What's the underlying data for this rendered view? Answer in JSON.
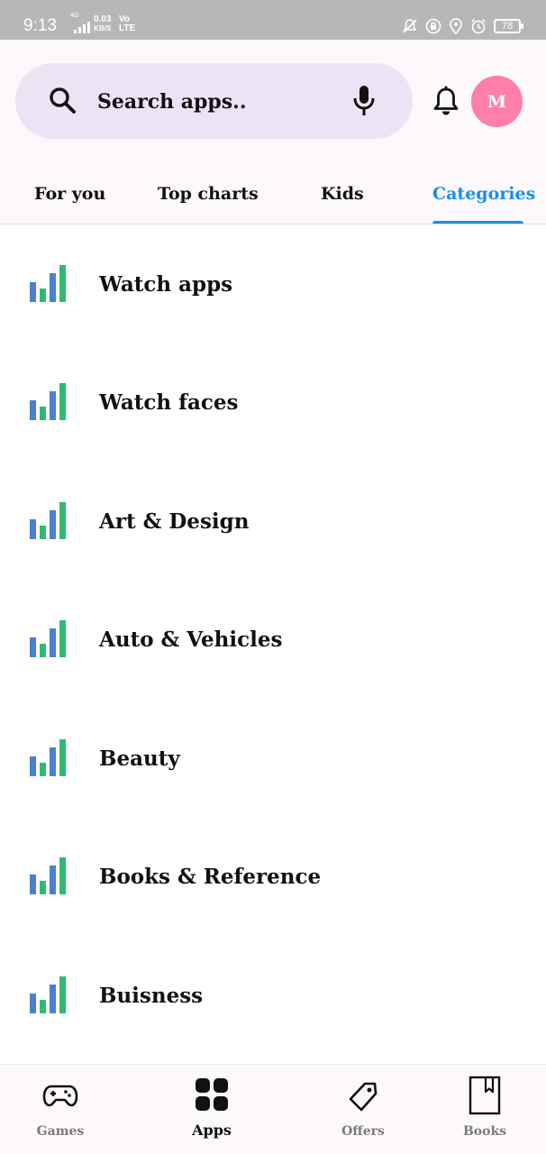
{
  "status_bar": {
    "time": "9:13",
    "network_type": "4G",
    "speed_value": "0.03",
    "speed_unit": "KB/S",
    "volte_top": "Vo",
    "volte_bottom": "LTE",
    "battery": "78"
  },
  "search": {
    "placeholder": "Search apps..",
    "mic_icon": "mic-icon",
    "search_icon": "search-icon"
  },
  "header": {
    "notification_icon": "bell-icon",
    "avatar_letter": "M",
    "avatar_color": "#ff7fa8"
  },
  "tabs": [
    {
      "label": "For you",
      "active": false
    },
    {
      "label": "Top charts",
      "active": false
    },
    {
      "label": "Kids",
      "active": false
    },
    {
      "label": "Categories",
      "active": true
    }
  ],
  "categories": [
    {
      "label": "Watch apps",
      "icon": "category-bars-icon"
    },
    {
      "label": "Watch faces",
      "icon": "category-bars-icon"
    },
    {
      "label": "Art & Design",
      "icon": "category-bars-icon"
    },
    {
      "label": "Auto & Vehicles",
      "icon": "category-bars-icon"
    },
    {
      "label": "Beauty",
      "icon": "category-bars-icon"
    },
    {
      "label": "Books & Reference",
      "icon": "category-bars-icon"
    },
    {
      "label": "Buisness",
      "icon": "category-bars-icon"
    }
  ],
  "bottom_nav": [
    {
      "label": "Games",
      "icon": "gamepad-icon",
      "active": false
    },
    {
      "label": "Apps",
      "icon": "apps-grid-icon",
      "active": true
    },
    {
      "label": "Offers",
      "icon": "tag-icon",
      "active": false
    },
    {
      "label": "Books",
      "icon": "book-icon",
      "active": false
    }
  ],
  "colors": {
    "accent": "#1a8ee8",
    "search_bg": "#ece4f4",
    "header_bg": "#fcf8fc",
    "icon_blue": "#4a7fd4",
    "icon_green": "#2fba74"
  }
}
